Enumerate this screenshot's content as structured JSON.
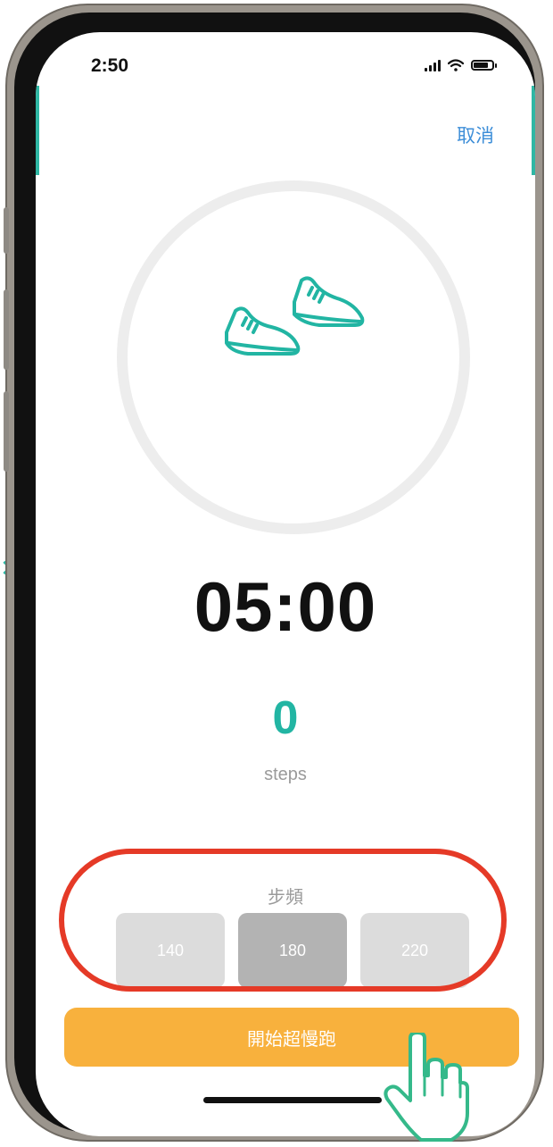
{
  "status_bar": {
    "time": "2:50"
  },
  "header": {
    "cancel_label": "取消"
  },
  "workout": {
    "timer": "05:00",
    "steps_count": "0",
    "steps_unit": "steps"
  },
  "cadence": {
    "label": "步頻",
    "options": [
      {
        "label": "140",
        "selected": false
      },
      {
        "label": "180",
        "selected": true
      },
      {
        "label": "220",
        "selected": false
      }
    ]
  },
  "start_button": {
    "label": "開始超慢跑"
  },
  "colors": {
    "accent_teal": "#22b5a3",
    "start_orange": "#f8b13d",
    "link_blue": "#3d8ed8",
    "highlight_red": "#e53a27"
  },
  "icons": [
    "shoes-icon",
    "signal-icon",
    "wifi-icon",
    "battery-icon",
    "hand-pointer-icon"
  ]
}
